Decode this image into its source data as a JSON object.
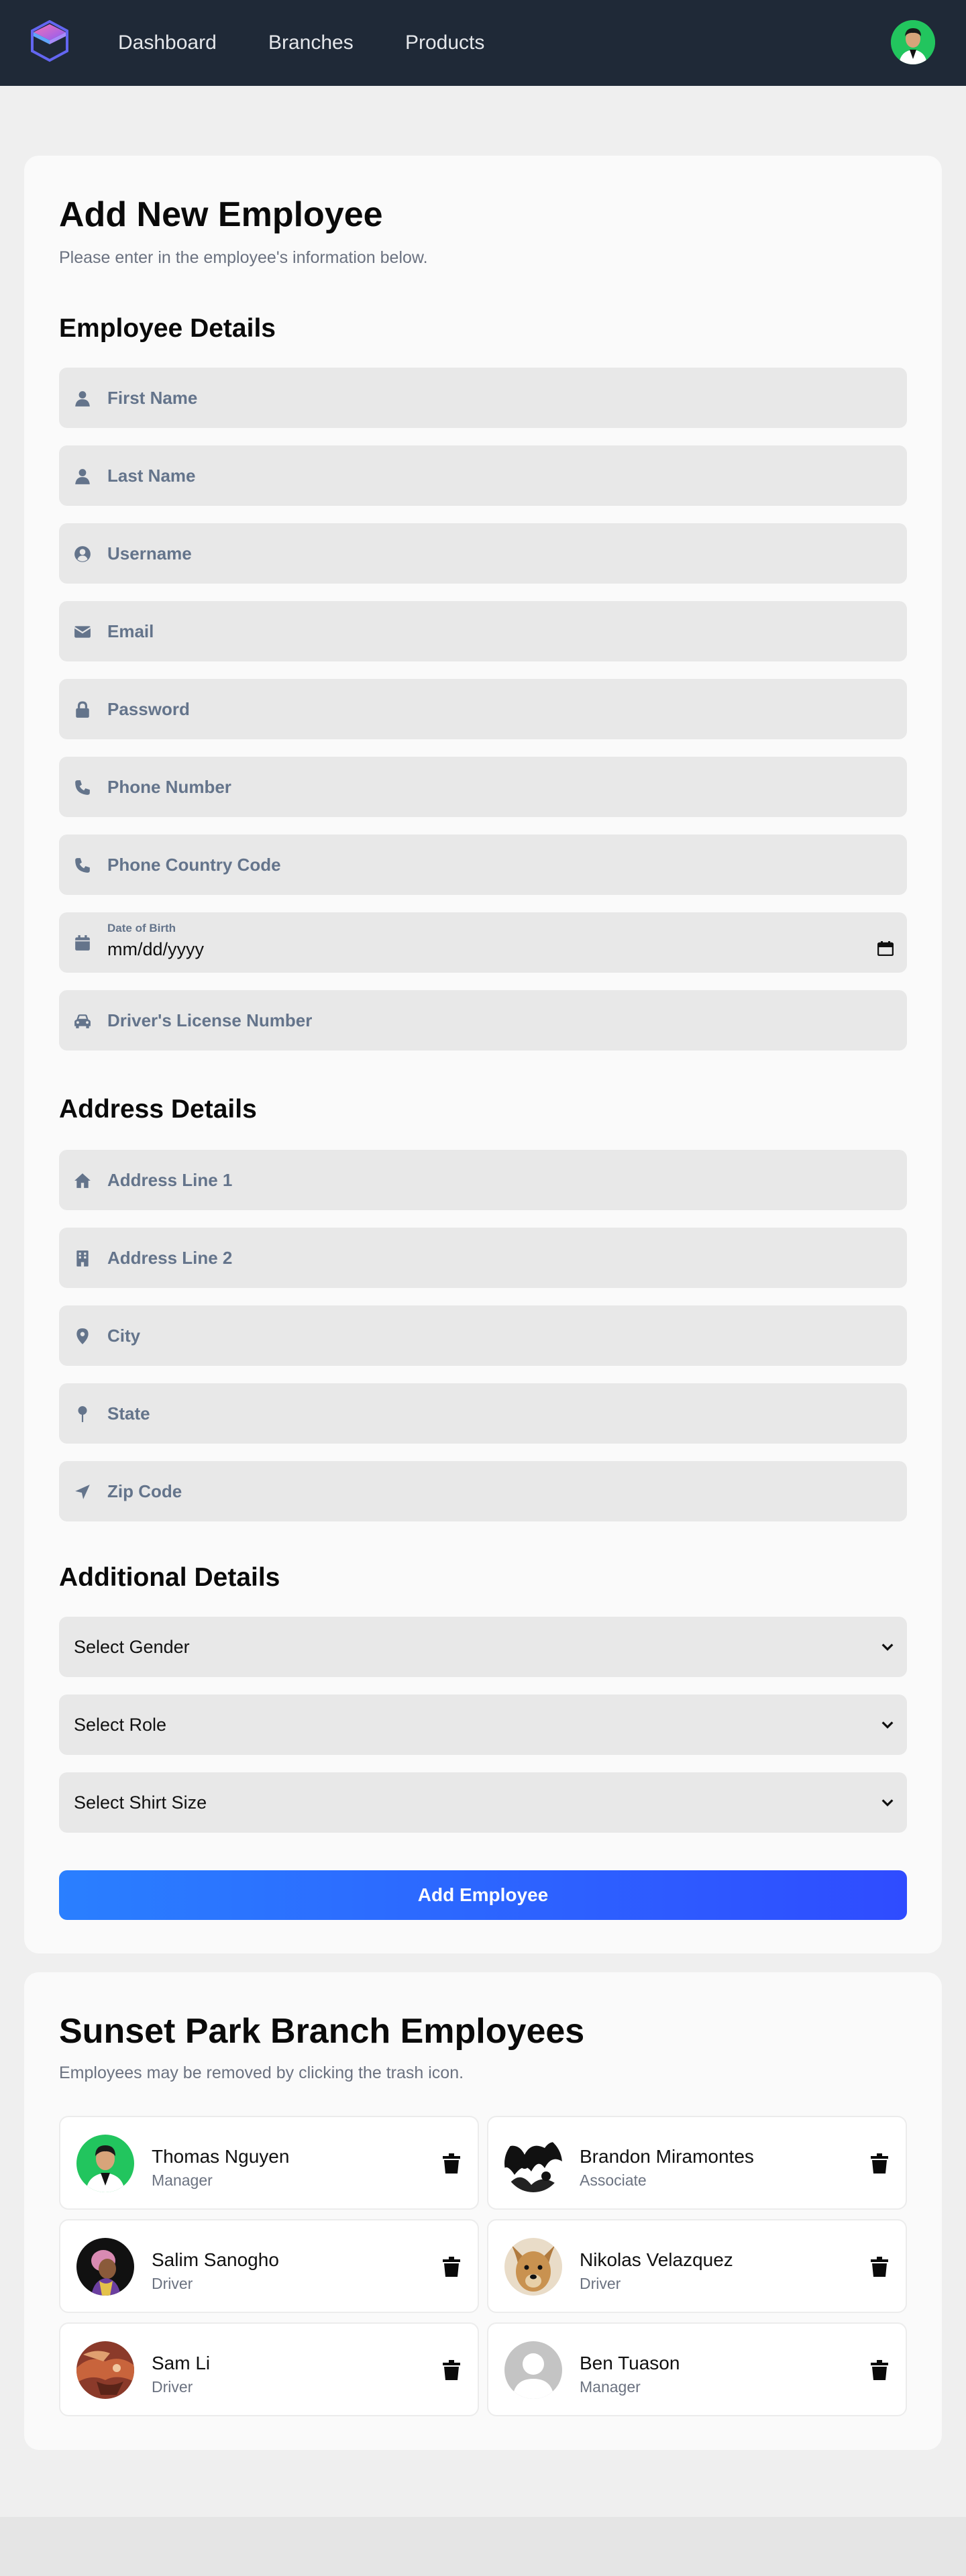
{
  "nav": {
    "links": [
      "Dashboard",
      "Branches",
      "Products"
    ]
  },
  "form": {
    "title": "Add New Employee",
    "subtitle": "Please enter in the employee's information below.",
    "employee_details": {
      "heading": "Employee Details",
      "fields": [
        {
          "icon": "user-icon",
          "placeholder": "First Name"
        },
        {
          "icon": "user-icon",
          "placeholder": "Last Name"
        },
        {
          "icon": "user-circle-icon",
          "placeholder": "Username"
        },
        {
          "icon": "envelope-icon",
          "placeholder": "Email"
        },
        {
          "icon": "lock-icon",
          "placeholder": "Password"
        },
        {
          "icon": "phone-icon",
          "placeholder": "Phone Number"
        },
        {
          "icon": "phone-icon",
          "placeholder": "Phone Country Code"
        }
      ],
      "dob": {
        "icon": "calendar-icon",
        "label": "Date of Birth",
        "value": "mm/dd/yyyy"
      },
      "license": {
        "icon": "car-icon",
        "placeholder": "Driver's License Number"
      }
    },
    "address_details": {
      "heading": "Address Details",
      "fields": [
        {
          "icon": "home-icon",
          "placeholder": "Address Line 1"
        },
        {
          "icon": "building-icon",
          "placeholder": "Address Line 2"
        },
        {
          "icon": "map-pin-icon",
          "placeholder": "City"
        },
        {
          "icon": "thumbtack-icon",
          "placeholder": "State"
        },
        {
          "icon": "location-arrow-icon",
          "placeholder": "Zip Code"
        }
      ]
    },
    "additional_details": {
      "heading": "Additional Details",
      "selects": [
        "Select Gender",
        "Select Role",
        "Select Shirt Size"
      ]
    },
    "submit_label": "Add Employee"
  },
  "employees": {
    "title": "Sunset Park Branch Employees",
    "subtitle": "Employees may be removed by clicking the trash icon.",
    "list": [
      {
        "name": "Thomas Nguyen",
        "role": "Manager"
      },
      {
        "name": "Brandon Miramontes",
        "role": "Associate"
      },
      {
        "name": "Salim Sanogho",
        "role": "Driver"
      },
      {
        "name": "Nikolas Velazquez",
        "role": "Driver"
      },
      {
        "name": "Sam Li",
        "role": "Driver"
      },
      {
        "name": "Ben Tuason",
        "role": "Manager"
      }
    ]
  },
  "colors": {
    "nav_bg": "#1f2937",
    "button_start": "#2a7fff",
    "button_end": "#2f4cff",
    "field_bg": "#e8e8e8"
  }
}
